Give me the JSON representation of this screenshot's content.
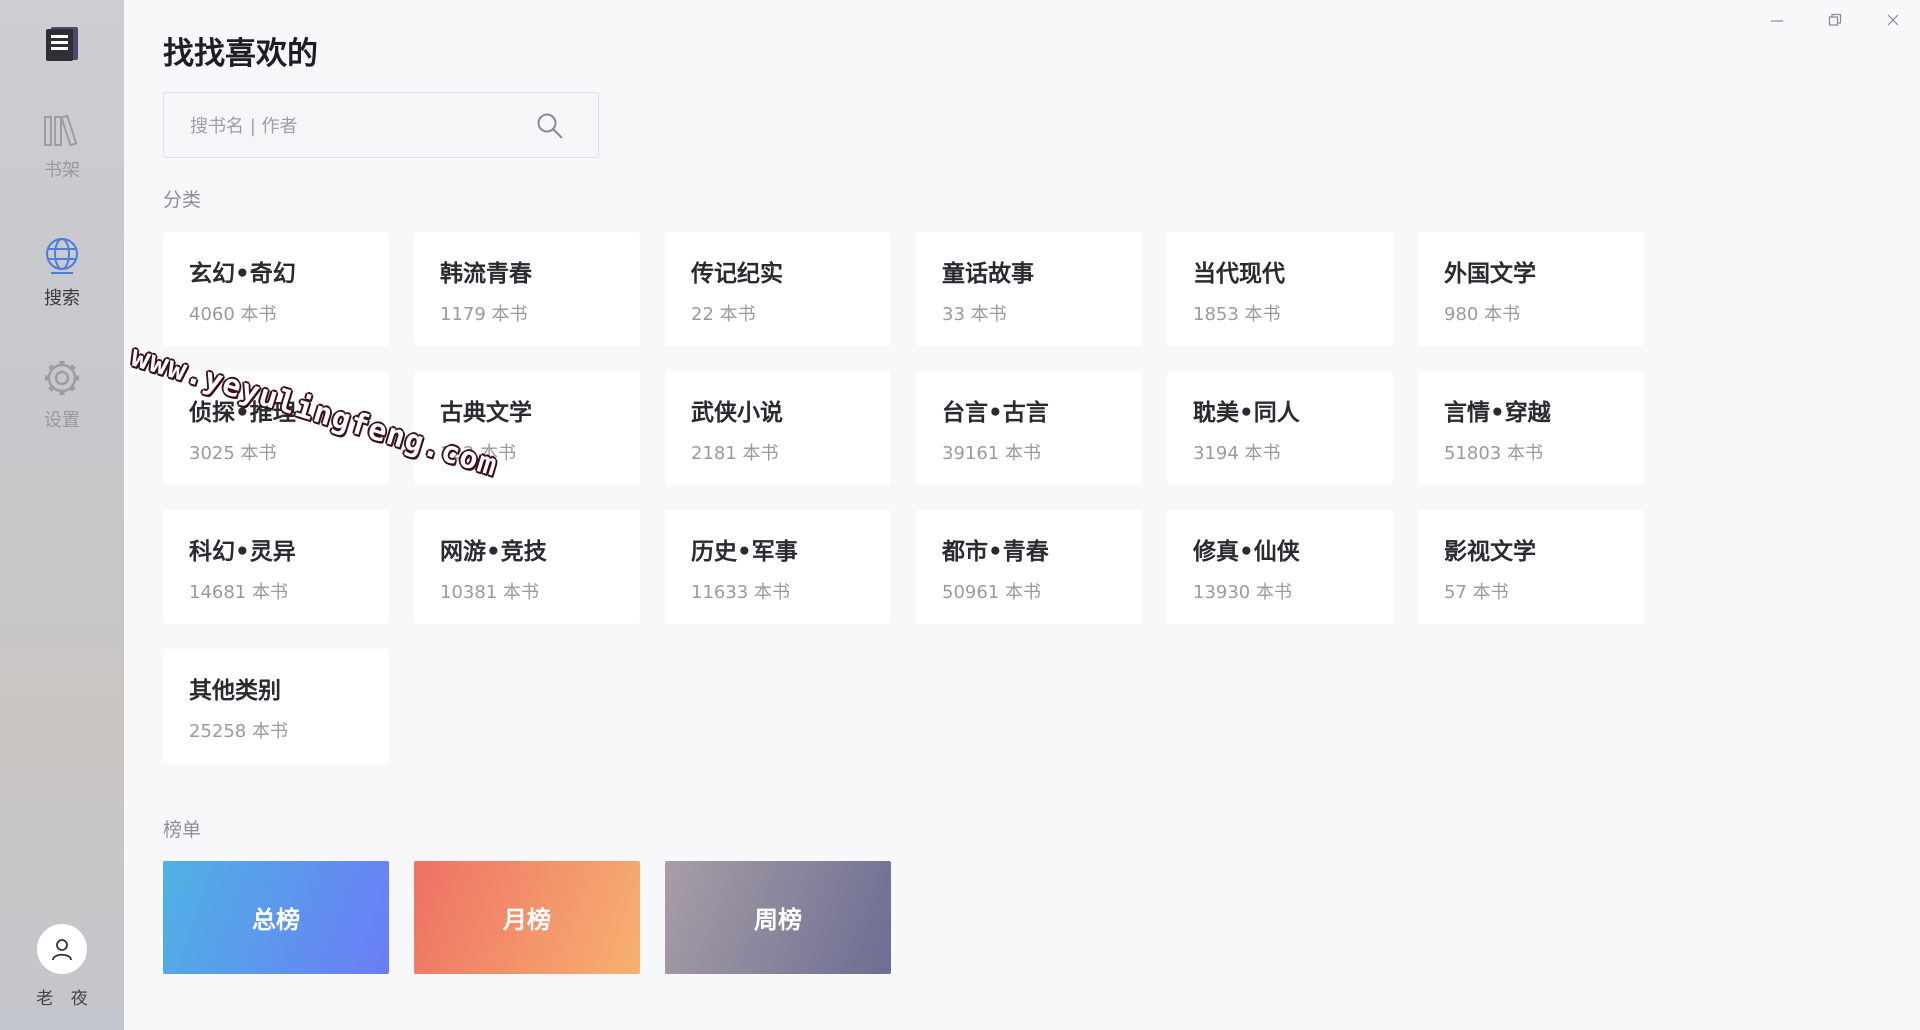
{
  "sidebar": {
    "nav": [
      {
        "label": "书架",
        "icon": "bookshelf-icon",
        "active": false
      },
      {
        "label": "搜索",
        "icon": "globe-icon",
        "active": true
      },
      {
        "label": "设置",
        "icon": "gear-icon",
        "active": false
      }
    ],
    "user_name": "老 夜"
  },
  "page": {
    "title": "找找喜欢的",
    "search_placeholder": "搜书名 | 作者",
    "categories_label": "分类",
    "rankings_label": "榜单"
  },
  "categories": [
    {
      "name": "玄幻•奇幻",
      "count": "4060 本书"
    },
    {
      "name": "韩流青春",
      "count": "1179 本书"
    },
    {
      "name": "传记纪实",
      "count": "22 本书"
    },
    {
      "name": "童话故事",
      "count": "33 本书"
    },
    {
      "name": "当代现代",
      "count": "1853 本书"
    },
    {
      "name": "外国文学",
      "count": "980 本书"
    },
    {
      "name": "侦探•推理",
      "count": "3025 本书"
    },
    {
      "name": "古典文学",
      "count": "122 本书"
    },
    {
      "name": "武侠小说",
      "count": "2181 本书"
    },
    {
      "name": "台言•古言",
      "count": "39161 本书"
    },
    {
      "name": "耽美•同人",
      "count": "3194 本书"
    },
    {
      "name": "言情•穿越",
      "count": "51803 本书"
    },
    {
      "name": "科幻•灵异",
      "count": "14681 本书"
    },
    {
      "name": "网游•竞技",
      "count": "10381 本书"
    },
    {
      "name": "历史•军事",
      "count": "11633 本书"
    },
    {
      "name": "都市•青春",
      "count": "50961 本书"
    },
    {
      "name": "修真•仙侠",
      "count": "13930 本书"
    },
    {
      "name": "影视文学",
      "count": "57 本书"
    },
    {
      "name": "其他类别",
      "count": "25258 本书"
    }
  ],
  "rankings": [
    {
      "label": "总榜",
      "style": "total"
    },
    {
      "label": "月榜",
      "style": "month"
    },
    {
      "label": "周榜",
      "style": "week"
    }
  ],
  "watermark": "www.yeyulingfeng.com",
  "colors": {
    "accent": "#4a7fe0",
    "rank_total": [
      "#4fb2e3",
      "#6a7cf6"
    ],
    "rank_month": [
      "#ee7164",
      "#f7b171"
    ],
    "rank_week": [
      "#a89ea6",
      "#6c6d93"
    ]
  }
}
